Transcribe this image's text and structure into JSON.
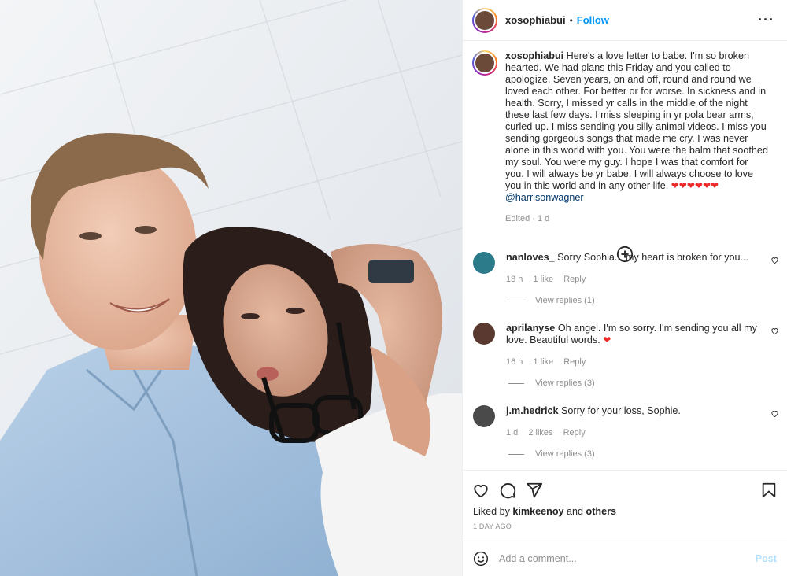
{
  "post": {
    "username": "xosophiabui",
    "dot": "•",
    "follow_label": "Follow",
    "more_icon": "more-horizontal-icon",
    "caption": {
      "username": "xosophiabui",
      "text": "Here's a love letter to babe. I'm so broken hearted. We had plans this Friday and you called to apologize. Seven years, on and off, round and round we loved each other. For better or for worse. In sickness and in health. Sorry, I missed yr calls in the middle of the night these last few days. I miss sleeping in yr pola bear arms, curled up. I miss sending you silly animal videos. I miss you sending gorgeous songs that made me cry. I was never alone in this world with you. You were the balm that soothed my soul. You were my guy. I hope I was that comfort for you. I will always be yr babe. I will always choose to love you in this world and in any other life.",
      "hearts": "❤❤❤❤❤❤",
      "mention": "@harrisonwagner",
      "meta": "Edited · 1 d"
    },
    "load_more_icon": "plus-circle-icon"
  },
  "comments": [
    {
      "username": "nanloves_",
      "text": "Sorry Sophia... my heart is broken for you...",
      "heart": "",
      "time": "18 h",
      "likes": "1 like",
      "reply_label": "Reply",
      "view_replies": "View replies (1)"
    },
    {
      "username": "aprilanyse",
      "text": "Oh angel. I'm so sorry. I'm sending you all my love. Beautiful words.",
      "heart": "❤",
      "time": "16 h",
      "likes": "1 like",
      "reply_label": "Reply",
      "view_replies": "View replies (3)"
    },
    {
      "username": "j.m.hedrick",
      "text": "Sorry for your loss, Sophie.",
      "heart": "",
      "time": "1 d",
      "likes": "2 likes",
      "reply_label": "Reply",
      "view_replies": "View replies (3)"
    }
  ],
  "actions": {
    "like_icon": "heart-icon",
    "comment_icon": "comment-icon",
    "share_icon": "share-icon",
    "save_icon": "bookmark-icon"
  },
  "likes": {
    "prefix": "Liked by",
    "user": "kimkeenoy",
    "and": "and",
    "others": "others"
  },
  "timestamp": "1 DAY AGO",
  "add_comment": {
    "placeholder": "Add a comment...",
    "post_label": "Post",
    "emoji_icon": "emoji-icon"
  },
  "colors": {
    "link_blue": "#0095f6",
    "post_disabled": "#b2dffc",
    "meta_gray": "#8e8e8e",
    "heart_red": "#ed2a2a"
  }
}
